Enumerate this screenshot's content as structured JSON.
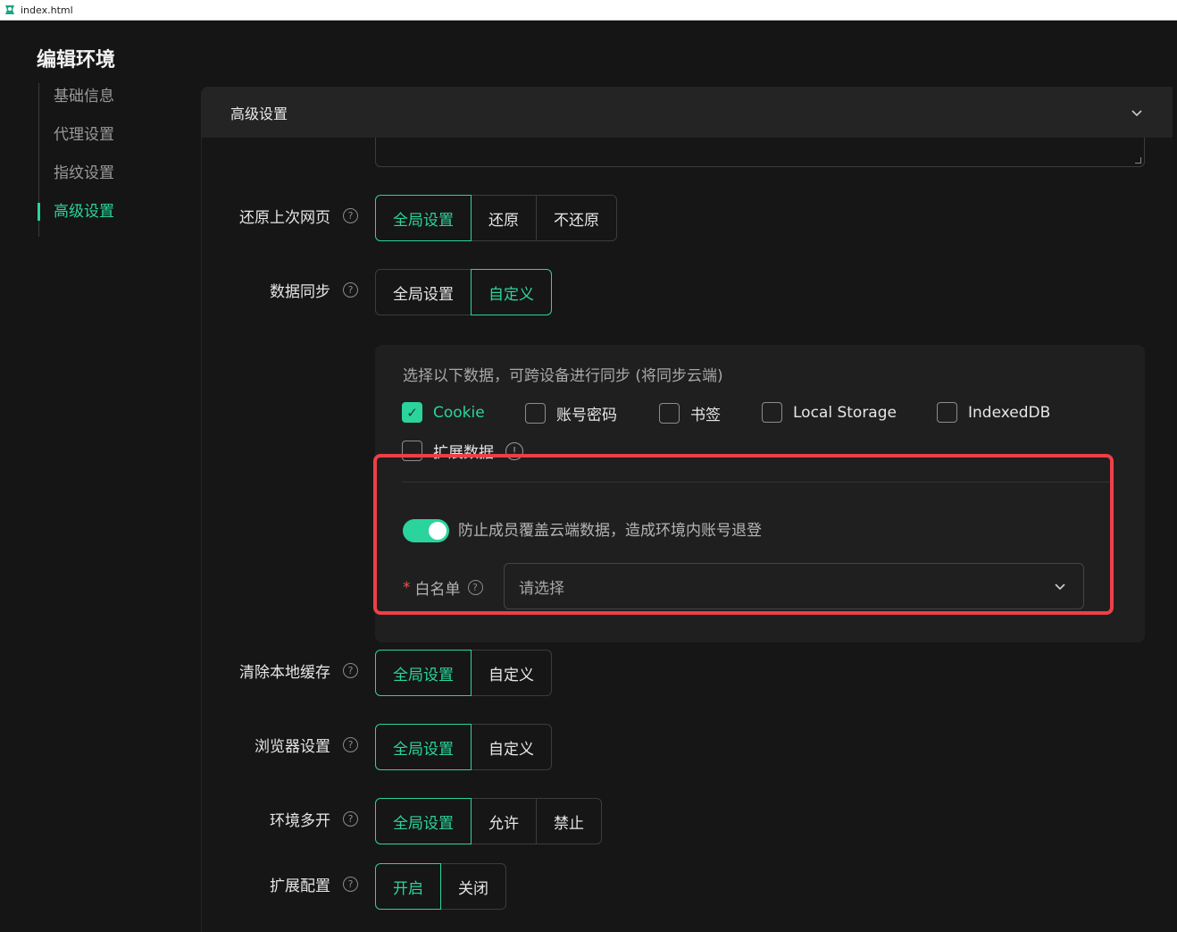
{
  "titlebar": {
    "title": "index.html"
  },
  "page_title": "编辑环境",
  "nav": {
    "items": [
      {
        "label": "基础信息"
      },
      {
        "label": "代理设置"
      },
      {
        "label": "指纹设置"
      },
      {
        "label": "高级设置",
        "active": true
      }
    ]
  },
  "panel": {
    "title": "高级设置"
  },
  "rows": {
    "restore": {
      "label": "还原上次网页",
      "options": [
        "全局设置",
        "还原",
        "不还原"
      ],
      "selected": "全局设置"
    },
    "sync": {
      "label": "数据同步",
      "options": [
        "全局设置",
        "自定义"
      ],
      "selected": "自定义"
    },
    "clear_cache": {
      "label": "清除本地缓存",
      "options": [
        "全局设置",
        "自定义"
      ],
      "selected": "全局设置"
    },
    "browser": {
      "label": "浏览器设置",
      "options": [
        "全局设置",
        "自定义"
      ],
      "selected": "全局设置"
    },
    "multi_open": {
      "label": "环境多开",
      "options": [
        "全局设置",
        "允许",
        "禁止"
      ],
      "selected": "全局设置"
    },
    "extension": {
      "label": "扩展配置",
      "options": [
        "开启",
        "关闭"
      ],
      "selected": "开启"
    }
  },
  "sync_box": {
    "description": "选择以下数据，可跨设备进行同步 (将同步云端)",
    "checkboxes": [
      {
        "label": "Cookie",
        "checked": true
      },
      {
        "label": "账号密码",
        "checked": false
      },
      {
        "label": "书签",
        "checked": false
      },
      {
        "label": "Local Storage",
        "checked": false
      },
      {
        "label": "IndexedDB",
        "checked": false
      },
      {
        "label": "扩展数据",
        "checked": false
      }
    ],
    "toggle_label": "防止成员覆盖云端数据，造成环境内账号退登",
    "toggle_on": true,
    "whitelist": {
      "required_mark": "*",
      "label": "白名单",
      "placeholder": "请选择"
    }
  },
  "colors": {
    "accent": "#2bd49c",
    "highlight": "#ee3f48",
    "background": "#151515"
  },
  "icons": {
    "help": "question-circle-icon",
    "info": "exclamation-circle-icon",
    "chevron": "chevron-down-icon"
  }
}
